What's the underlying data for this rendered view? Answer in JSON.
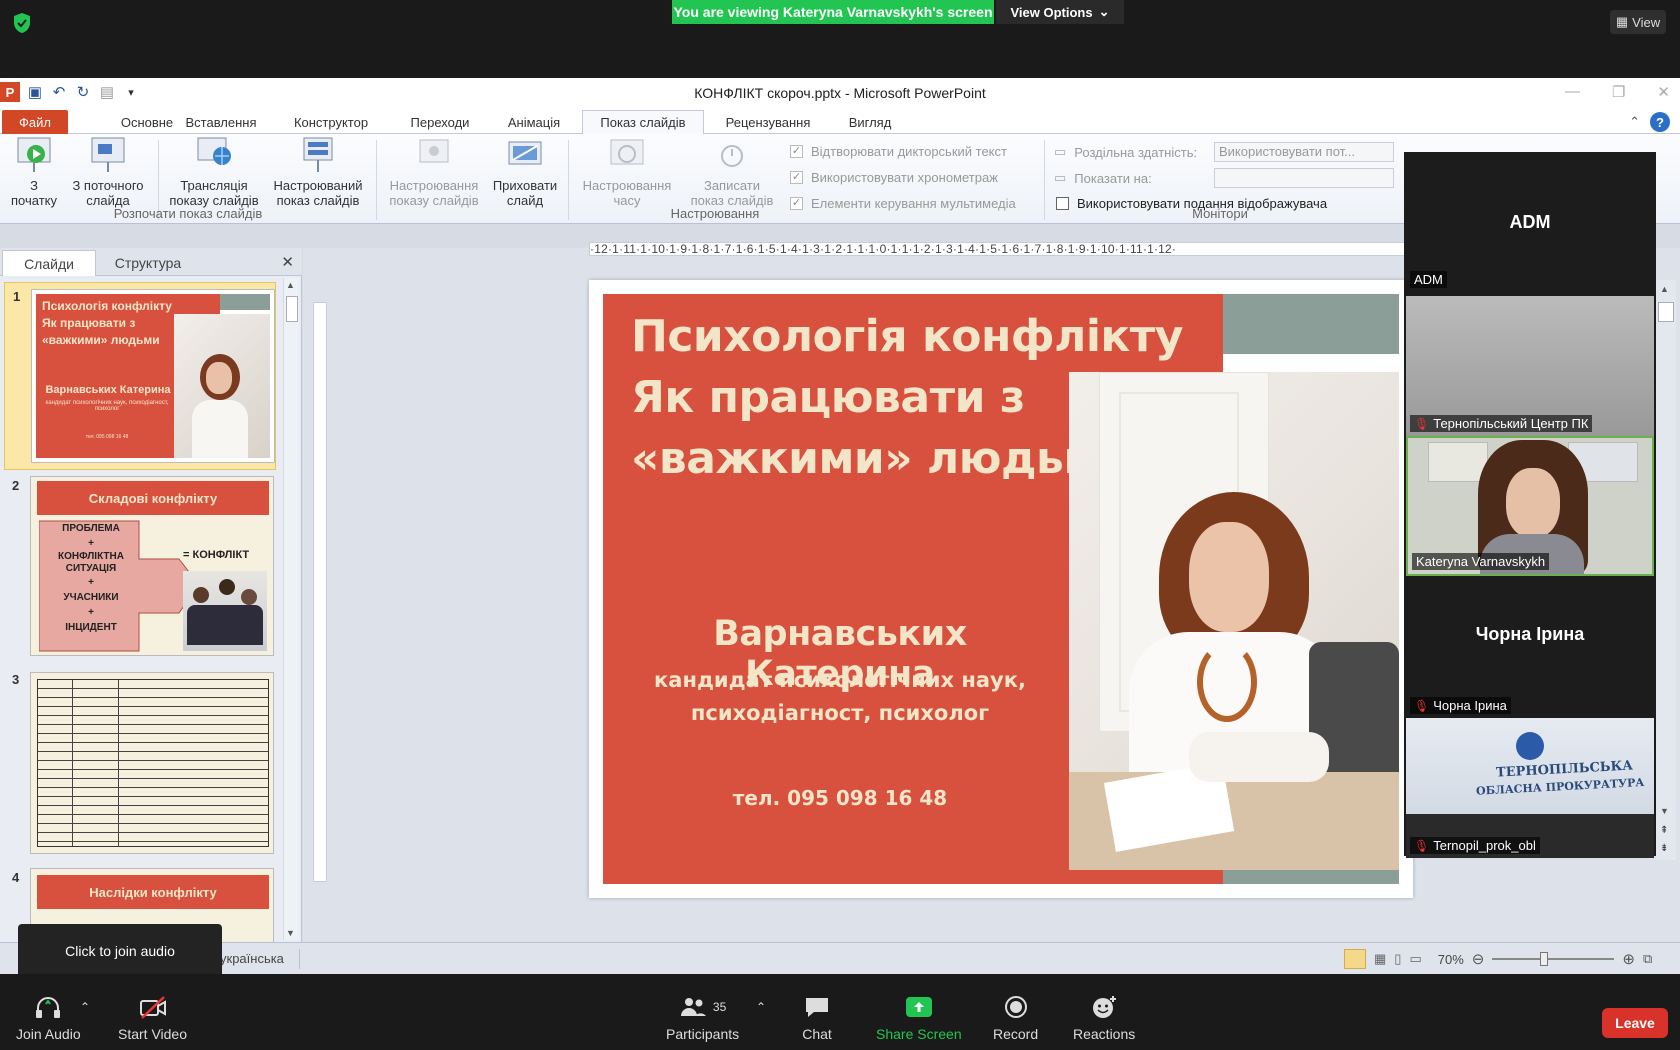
{
  "zoom": {
    "banner": "You are viewing Kateryna Varnavskykh's screen",
    "view_options": "View Options",
    "view": "View",
    "tooltip": "Click to join audio",
    "bottom": {
      "join_audio": "Join Audio",
      "start_video": "Start Video",
      "participants": "Participants",
      "participants_count": "35",
      "chat": "Chat",
      "share_screen": "Share Screen",
      "record": "Record",
      "reactions": "Reactions",
      "leave": "Leave"
    },
    "gallery": [
      {
        "display_name": "ADM",
        "label": "ADM",
        "muted": false,
        "kind": "name"
      },
      {
        "display_name": "",
        "label": "Тернопільський Центр ПК",
        "muted": true,
        "kind": "video-gray"
      },
      {
        "display_name": "",
        "label": "Kateryna Varnavskykh",
        "muted": false,
        "kind": "video-person"
      },
      {
        "display_name": "Чорна Ірина",
        "label": "Чорна Ірина",
        "muted": true,
        "kind": "name"
      },
      {
        "display_name": "",
        "label": "Ternopil_prok_obl",
        "muted": true,
        "kind": "video-hall"
      }
    ],
    "hall_text_1": "ТЕРНОПІЛЬСЬКА",
    "hall_text_2": "ОБЛАСНА ПРОКУРАТУРА"
  },
  "ppt": {
    "window_title": "КОНФЛІКТ скороч.pptx  -  Microsoft PowerPoint",
    "tabs": [
      "Файл",
      "Основне",
      "Вставлення",
      "Конструктор",
      "Переходи",
      "Анімація",
      "Показ слайдів",
      "Рецензування",
      "Вигляд"
    ],
    "active_tab": "Показ слайдів",
    "ribbon": {
      "from_start": "З\nпочатку",
      "from_current": "З поточного\nслайда",
      "broadcast": "Трансляція\nпоказу слайдів",
      "custom": "Настроюваний\nпоказ слайдів",
      "group_start": "Розпочати показ слайдів",
      "setup": "Настроювання\nпоказу слайдів",
      "hide": "Приховати\nслайд",
      "timings": "Настроювання\nчасу",
      "record": "Записати\nпоказ слайдів",
      "chk_narration": "Відтворювати дикторський текст",
      "chk_timings": "Використовувати хронометраж",
      "chk_media": "Елементи керування мультимедіа",
      "group_setup": "Настроювання",
      "resolution_label": "Роздільна здатність:",
      "resolution_value": "Використовувати пот...",
      "show_on_label": "Показати на:",
      "presenter_view": "Використовувати подання відображувача",
      "group_monitors": "Монітори"
    },
    "pane_tabs": [
      "Слайди",
      "Структура"
    ],
    "ruler_h": "·12·1·11·1·10·1·9·1·8·1·7·1·6·1·5·1·4·1·3·1·2·1·1·1·0·1·1·1·2·1·3·1·4·1·5·1·6·1·7·1·8·1·9·1·10·1·11·1·12·",
    "thumbs": {
      "t1_title": "Психологія конфлікту Як працювати з «важкими» людьми",
      "t1_name": "Варнавських Катерина",
      "t1_sub": "кандидат психологічних наук, психодіагност, психолог",
      "t1_phone": "тел. 095 098 16 48",
      "t2_title": "Складові конфлікту",
      "t2_lines": [
        "ПРОБЛЕМА",
        "+",
        "КОНФЛІКТНА СИТУАЦІЯ",
        "+",
        "УЧАСНИКИ",
        "+",
        "ІНЦИДЕНТ"
      ],
      "t2_eq": "= КОНФЛІКТ",
      "t4_title": "Наслідки конфлікту",
      "nums": [
        "1",
        "2",
        "3",
        "4"
      ]
    },
    "slide": {
      "title_lines": [
        "Психологія конфлікту",
        "Як працювати з",
        "«важкими» людьми"
      ],
      "name": "Варнавських Катерина",
      "sub_lines": [
        "кандидат психологічних наук,",
        "психодіагност, психолог"
      ],
      "phone": "тел. 095 098 16 48"
    },
    "status": {
      "lang": "українська",
      "zoom": "70%"
    }
  }
}
